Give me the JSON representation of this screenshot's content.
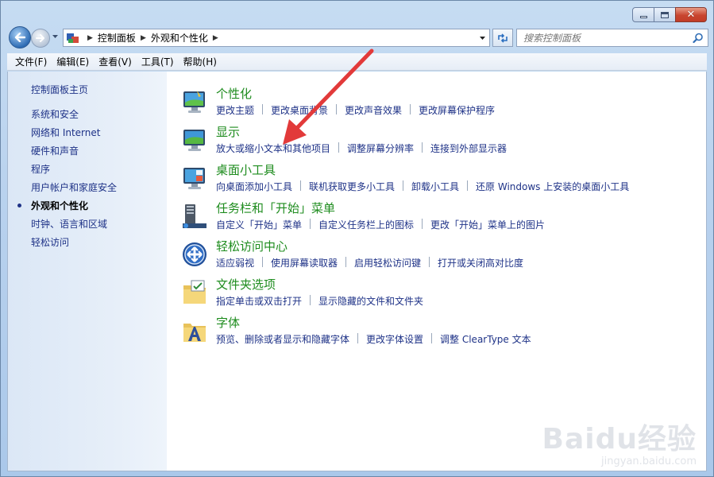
{
  "window": {
    "caption": {
      "minimize": "minimize",
      "maximize": "maximize",
      "close": "close"
    }
  },
  "nav": {
    "breadcrumb": [
      "控制面板",
      "外观和个性化"
    ],
    "search_placeholder": "搜索控制面板"
  },
  "menu": [
    "文件(F)",
    "编辑(E)",
    "查看(V)",
    "工具(T)",
    "帮助(H)"
  ],
  "sidebar": {
    "home": "控制面板主页",
    "items": [
      {
        "label": "系统和安全",
        "current": false
      },
      {
        "label": "网络和 Internet",
        "current": false
      },
      {
        "label": "硬件和声音",
        "current": false
      },
      {
        "label": "程序",
        "current": false
      },
      {
        "label": "用户帐户和家庭安全",
        "current": false
      },
      {
        "label": "外观和个性化",
        "current": true
      },
      {
        "label": "时钟、语言和区域",
        "current": false
      },
      {
        "label": "轻松访问",
        "current": false
      }
    ]
  },
  "categories": [
    {
      "title": "个性化",
      "icon": "personalization-icon",
      "links": [
        "更改主题",
        "更改桌面背景",
        "更改声音效果",
        "更改屏幕保护程序"
      ]
    },
    {
      "title": "显示",
      "icon": "display-icon",
      "links": [
        "放大或缩小文本和其他项目",
        "调整屏幕分辨率",
        "连接到外部显示器"
      ]
    },
    {
      "title": "桌面小工具",
      "icon": "gadgets-icon",
      "links": [
        "向桌面添加小工具",
        "联机获取更多小工具",
        "卸载小工具",
        "还原 Windows 上安装的桌面小工具"
      ]
    },
    {
      "title": "任务栏和「开始」菜单",
      "icon": "taskbar-icon",
      "links": [
        "自定义「开始」菜单",
        "自定义任务栏上的图标",
        "更改「开始」菜单上的图片"
      ]
    },
    {
      "title": "轻松访问中心",
      "icon": "ease-of-access-icon",
      "links": [
        "适应弱视",
        "使用屏幕读取器",
        "启用轻松访问键",
        "打开或关闭高对比度"
      ]
    },
    {
      "title": "文件夹选项",
      "icon": "folder-options-icon",
      "links": [
        "指定单击或双击打开",
        "显示隐藏的文件和文件夹"
      ]
    },
    {
      "title": "字体",
      "icon": "fonts-icon",
      "links": [
        "预览、删除或者显示和隐藏字体",
        "更改字体设置",
        "调整 ClearType 文本"
      ]
    }
  ],
  "watermark": {
    "logo": "Baidu经验",
    "url": "jingyan.baidu.com"
  },
  "colors": {
    "link": "#1e3287",
    "category_title": "#1e8c1e",
    "annotation_arrow": "#e23a3a"
  }
}
